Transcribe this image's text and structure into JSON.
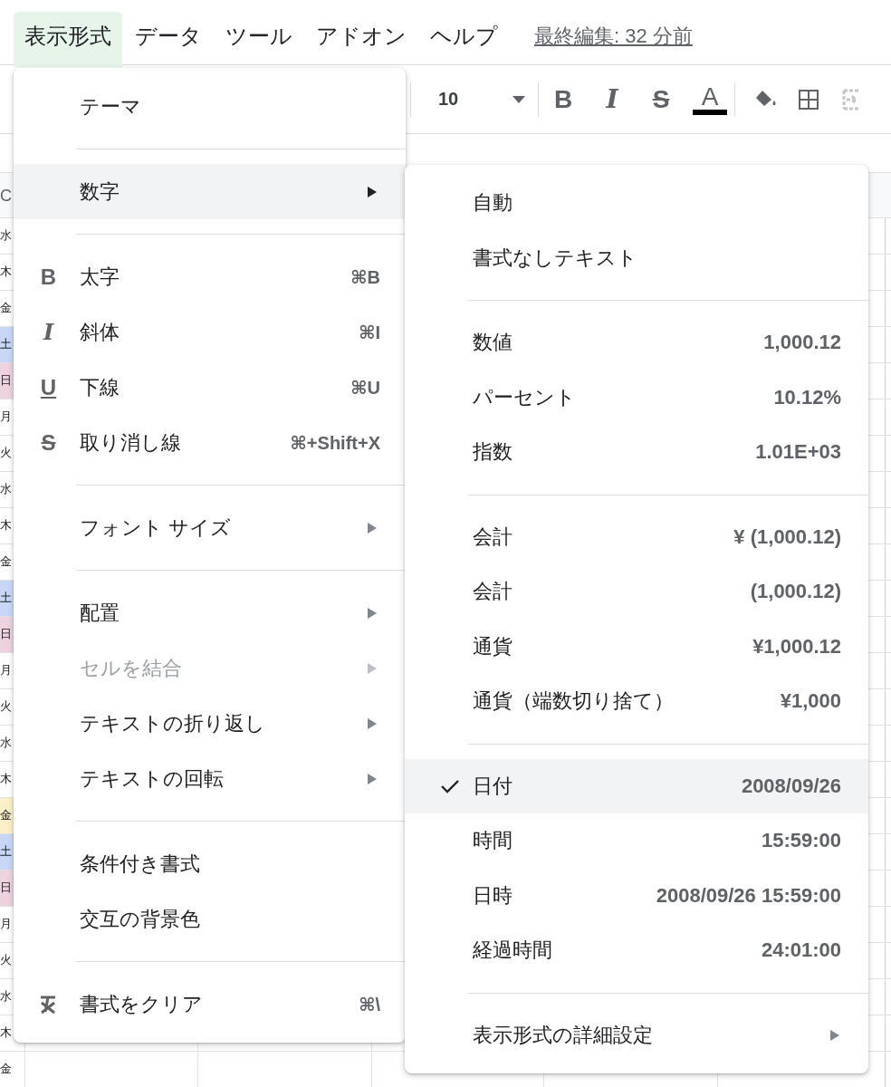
{
  "menubar": {
    "items": [
      {
        "label": "表示形式",
        "selected": true
      },
      {
        "label": "データ",
        "selected": false
      },
      {
        "label": "ツール",
        "selected": false
      },
      {
        "label": "アドオン",
        "selected": false
      },
      {
        "label": "ヘルプ",
        "selected": false
      }
    ],
    "last_edit": "最終編集: 32 分前"
  },
  "toolbar": {
    "font_size": "10",
    "buttons": [
      {
        "kind": "bold",
        "glyph": "B"
      },
      {
        "kind": "italic",
        "glyph": "I"
      },
      {
        "kind": "strike",
        "glyph": "S"
      },
      {
        "kind": "text-color",
        "glyph": "A"
      },
      {
        "kind": "fill"
      },
      {
        "kind": "borders"
      },
      {
        "kind": "merge"
      }
    ]
  },
  "sheet": {
    "column_header": "C",
    "cells": [
      {
        "text": "水"
      },
      {
        "text": "木"
      },
      {
        "text": "金"
      },
      {
        "text": "土",
        "color": "#c9d7f7"
      },
      {
        "text": "日",
        "color": "#ecd3df"
      },
      {
        "text": "月"
      },
      {
        "text": "火"
      },
      {
        "text": "水"
      },
      {
        "text": "木"
      },
      {
        "text": "金"
      },
      {
        "text": "土",
        "color": "#c9d7f7"
      },
      {
        "text": "日",
        "color": "#ecd3df"
      },
      {
        "text": "月"
      },
      {
        "text": "火"
      },
      {
        "text": "水"
      },
      {
        "text": "木"
      },
      {
        "text": "金",
        "color": "#fdefc8"
      },
      {
        "text": "土",
        "color": "#c9d7f7"
      },
      {
        "text": "日",
        "color": "#ecd3df"
      },
      {
        "text": "月"
      },
      {
        "text": "火"
      },
      {
        "text": "水"
      },
      {
        "text": "木"
      },
      {
        "text": "金"
      }
    ]
  },
  "format_menu": {
    "groups": [
      [
        {
          "label": "テーマ",
          "kind": "plain",
          "submenu": false,
          "disabled": false,
          "selected": false
        }
      ],
      [
        {
          "label": "数字",
          "kind": "plain",
          "submenu": true,
          "disabled": false,
          "selected": true
        }
      ],
      [
        {
          "label": "太字",
          "kind": "bold",
          "glyph": "B",
          "shortcut": "⌘B",
          "submenu": false,
          "disabled": false,
          "selected": false
        },
        {
          "label": "斜体",
          "kind": "italic",
          "glyph": "I",
          "shortcut": "⌘I",
          "submenu": false,
          "disabled": false,
          "selected": false
        },
        {
          "label": "下線",
          "kind": "underline",
          "glyph": "U",
          "shortcut": "⌘U",
          "submenu": false,
          "disabled": false,
          "selected": false
        },
        {
          "label": "取り消し線",
          "kind": "strike",
          "glyph": "S",
          "shortcut": "⌘+Shift+X",
          "submenu": false,
          "disabled": false,
          "selected": false
        }
      ],
      [
        {
          "label": "フォント サイズ",
          "kind": "plain",
          "submenu": true,
          "disabled": false,
          "selected": false
        }
      ],
      [
        {
          "label": "配置",
          "kind": "plain",
          "submenu": true,
          "disabled": false,
          "selected": false
        },
        {
          "label": "セルを結合",
          "kind": "plain",
          "submenu": true,
          "disabled": true,
          "selected": false
        },
        {
          "label": "テキストの折り返し",
          "kind": "plain",
          "submenu": true,
          "disabled": false,
          "selected": false
        },
        {
          "label": "テキストの回転",
          "kind": "plain",
          "submenu": true,
          "disabled": false,
          "selected": false
        }
      ],
      [
        {
          "label": "条件付き書式",
          "kind": "plain",
          "submenu": false,
          "disabled": false,
          "selected": false
        },
        {
          "label": "交互の背景色",
          "kind": "plain",
          "submenu": false,
          "disabled": false,
          "selected": false
        }
      ],
      [
        {
          "label": "書式をクリア",
          "kind": "clear",
          "shortcut": "⌘\\",
          "submenu": false,
          "disabled": false,
          "selected": false
        }
      ]
    ]
  },
  "number_menu": {
    "groups": [
      [
        {
          "label": "自動",
          "checked": false,
          "selected": false,
          "submenu": false
        },
        {
          "label": "書式なしテキスト",
          "checked": false,
          "selected": false,
          "submenu": false
        }
      ],
      [
        {
          "label": "数値",
          "example": "1,000.12",
          "checked": false,
          "selected": false,
          "submenu": false
        },
        {
          "label": "パーセント",
          "example": "10.12%",
          "checked": false,
          "selected": false,
          "submenu": false
        },
        {
          "label": "指数",
          "example": "1.01E+03",
          "checked": false,
          "selected": false,
          "submenu": false
        }
      ],
      [
        {
          "label": "会計",
          "example": "¥ (1,000.12)",
          "checked": false,
          "selected": false,
          "submenu": false
        },
        {
          "label": "会計",
          "example": "(1,000.12)",
          "checked": false,
          "selected": false,
          "submenu": false
        },
        {
          "label": "通貨",
          "example": "¥1,000.12",
          "checked": false,
          "selected": false,
          "submenu": false
        },
        {
          "label": "通貨（端数切り捨て）",
          "example": "¥1,000",
          "checked": false,
          "selected": false,
          "submenu": false
        }
      ],
      [
        {
          "label": "日付",
          "example": "2008/09/26",
          "checked": true,
          "selected": true,
          "submenu": false
        },
        {
          "label": "時間",
          "example": "15:59:00",
          "checked": false,
          "selected": false,
          "submenu": false
        },
        {
          "label": "日時",
          "example": "2008/09/26 15:59:00",
          "checked": false,
          "selected": false,
          "submenu": false
        },
        {
          "label": "経過時間",
          "example": "24:01:00",
          "checked": false,
          "selected": false,
          "submenu": false
        }
      ],
      [
        {
          "label": "表示形式の詳細設定",
          "checked": false,
          "selected": false,
          "submenu": true
        }
      ]
    ]
  }
}
